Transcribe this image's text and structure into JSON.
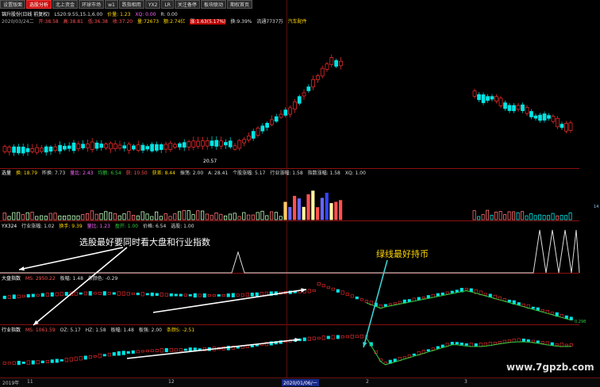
{
  "tabs": [
    "设置版面",
    "选股分析",
    "北上资金",
    "环球市场",
    "w1",
    "跌指相用",
    "YX2",
    "LR",
    "关注备停",
    "板块联动",
    "期权首页"
  ],
  "active_tab_index": 1,
  "stock": {
    "name": "锦升股份(日线 前复权)",
    "ma": "LS20:9.55,15.1,6.00",
    "vol": "价量: 1.23",
    "xq": "XQ: 0.00",
    "rq": "R: 0.00",
    "date": "2020/03/24二",
    "open": "开:38.58",
    "high": "高:38.81",
    "low": "低:36.38",
    "close": "收:37.20",
    "amount": "量:72673",
    "money": "额:2.74亿",
    "change": "涨:1.63(5.17%)",
    "turnover": "换:9.39%",
    "circ": "流通7737万",
    "industry": "汽车配件"
  },
  "main_chart": {
    "low_label": "20.57"
  },
  "sub1": {
    "name": "选量",
    "items": [
      "换: 18.79",
      "昨换: 7.73",
      "量比: 2.43",
      "均额: 6.54",
      "获: 10.50",
      "获差: 8.44",
      "振荡: 2.00",
      "A: 28.41",
      "个股涨幅: 5.17",
      "行业涨幅: 1.58",
      "指数涨幅: 1.58",
      "XQ: 1.00"
    ],
    "scale_top": "14"
  },
  "sub2": {
    "name": "YX324",
    "items": [
      "行业涨幅: 1.02",
      "换手: 9.39",
      "量比: 1.23",
      "盈开: 1.00",
      "价格: 6.54",
      "选股: 1.00"
    ]
  },
  "dapan": {
    "name": "大盘指数",
    "ma": "MS: 2950.22",
    "items": [
      "板幅: 1.48",
      "条颜色: -0.29"
    ],
    "right_label": "0.298"
  },
  "hangye": {
    "name": "行业指数",
    "ma": "MS: 1061.59",
    "items": [
      "OZ: 5.17",
      "HZ: 1.58",
      "板幅: 1.48",
      "板强: 2.00",
      "条颜S: -2.51"
    ]
  },
  "annotations": {
    "main_tip": "选股最好要同时看大盘和行业指数",
    "green_tip": "绿线最好持币"
  },
  "bottom_axis": {
    "year": "2019年",
    "m11": "11",
    "m12": "12",
    "date_hl": "2020/01/06/一",
    "m2": "2",
    "m3": "3"
  },
  "watermark": "www.7gpzb.com",
  "colors": {
    "up": "#ff3030",
    "down": "#00e5e5",
    "grid": "#8a1010",
    "text_yellow": "#ffd700",
    "ma_green": "#2ecc40"
  }
}
